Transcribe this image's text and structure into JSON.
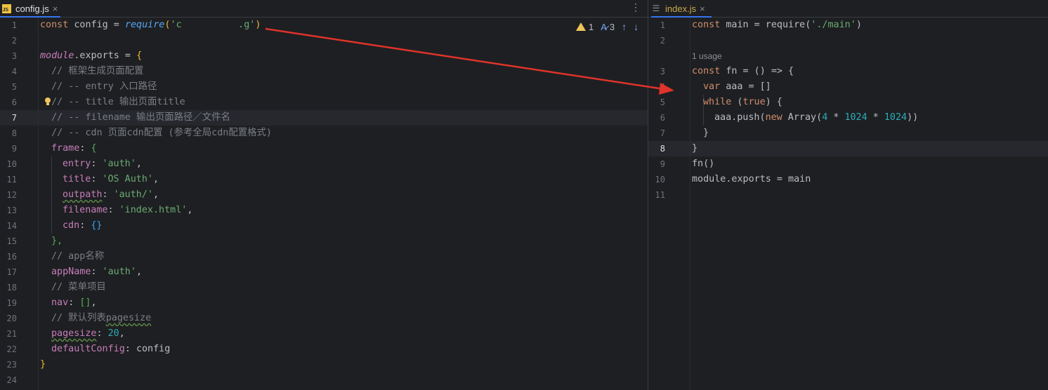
{
  "left_tab": {
    "filename": "config.js",
    "icon": "js-file-icon",
    "close": "×"
  },
  "right_tab": {
    "filename": "index.js",
    "icon": "structure-icon",
    "close": "×"
  },
  "inspections": {
    "warnings": "1",
    "typos": "3"
  },
  "left_gutter": [
    "1",
    "2",
    "3",
    "4",
    "5",
    "6",
    "7",
    "8",
    "9",
    "10",
    "11",
    "12",
    "13",
    "14",
    "15",
    "16",
    "17",
    "18",
    "19",
    "20",
    "21",
    "22",
    "23",
    "24"
  ],
  "left_current_line": "7",
  "left_code": {
    "l1_const": "const",
    "l1_name": " config = ",
    "l1_fn": "require",
    "l1_open": "(",
    "l1_str": "'ϲ          .g'",
    "l1_close": ")",
    "l3_module": "module",
    "l3_exports": ".exports = ",
    "l3_brace": "{",
    "l4": "  // 框架生成页面配置",
    "l5": "  // -- entry 入口路径",
    "l6": "  // -- title 输出页面title",
    "l7": "  // -- filename 输出页面路径／文件名",
    "l8": "  // -- cdn 页面cdn配置 (参考全局cdn配置格式)",
    "l9_key": "frame",
    "l9_rest": ": ",
    "l9_brace": "{",
    "l10_key": "entry",
    "l10_val": "'auth'",
    "l11_key": "title",
    "l11_val": "'OS Auth'",
    "l12_key": "outpath",
    "l12_val": "'auth/'",
    "l13_key": "filename",
    "l13_val": "'index.html'",
    "l14_key": "cdn",
    "l14_val": "{}",
    "l15": "},",
    "l16": "// app名称",
    "l17_key": "appName",
    "l17_val": "'auth'",
    "l18": "// 菜单项目",
    "l19_key": "nav",
    "l19_val": "[]",
    "l20_prefix": "// 默认列表",
    "l20_word": "pagesize",
    "l21_key": "pagesize",
    "l21_val": "20",
    "l22_key": "defaultConfig",
    "l22_val": "config",
    "l23": "}"
  },
  "right_gutter": [
    "1",
    "2",
    "3",
    "4",
    "5",
    "6",
    "7",
    "8",
    "9",
    "10",
    "11"
  ],
  "right_current_line": "8",
  "right_code": {
    "usage_hint": "1 usage",
    "r1_const": "const",
    "r1_mid": " main = require(",
    "r1_str": "'./main'",
    "r1_end": ")",
    "r3_const": "const",
    "r3_mid": " fn = () => {",
    "r4_var": "var",
    "r4_mid": " aaa = []",
    "r5_while": "while",
    "r5_open": " (",
    "r5_true": "true",
    "r5_end": ") {",
    "r6_a": "aaa.push(",
    "r6_new": "new",
    "r6_arr": " Array(",
    "r6_n1": "4",
    "r6_star1": " * ",
    "r6_n2": "1024",
    "r6_star2": " * ",
    "r6_n3": "1024",
    "r6_end": "))",
    "r7": "}",
    "r8": "}",
    "r9": "fn()",
    "r10": "module.exports = main"
  },
  "colors": {
    "background": "#1e1f22",
    "keyword": "#cf8e6d",
    "string": "#6aab73",
    "number": "#2aacb8",
    "comment": "#7a7e85",
    "property": "#c77dbb",
    "annotation_arrow": "#e0332a"
  }
}
